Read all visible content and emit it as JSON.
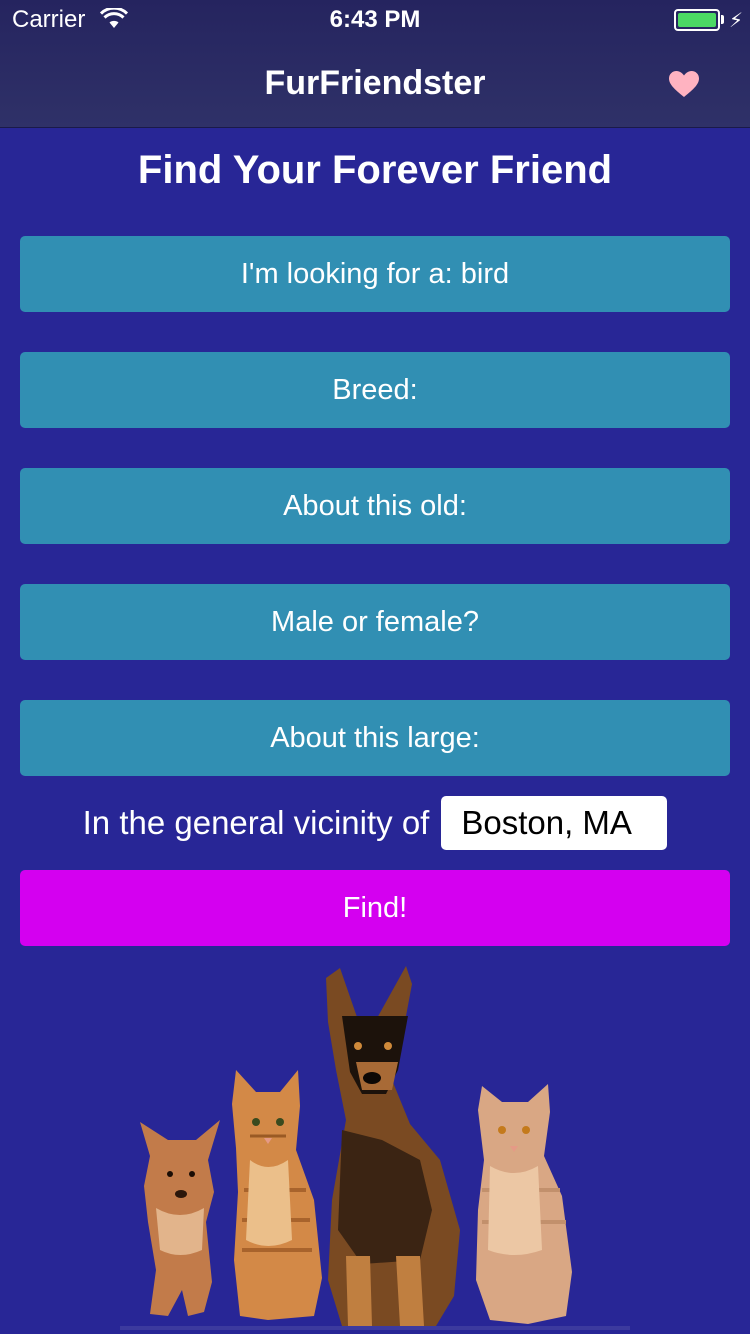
{
  "status_bar": {
    "carrier": "Carrier",
    "time": "6:43 PM"
  },
  "nav": {
    "title": "FurFriendster",
    "favorite_icon": "heart-icon"
  },
  "heading": "Find Your Forever Friend",
  "options": [
    {
      "label": "I'm looking for a: bird"
    },
    {
      "label": "Breed:"
    },
    {
      "label": "About this old:"
    },
    {
      "label": "Male or female?"
    },
    {
      "label": "About this large:"
    }
  ],
  "location": {
    "label": "In the general vicinity of",
    "value": "Boston, MA"
  },
  "find_label": "Find!",
  "colors": {
    "background": "#282696",
    "option_button": "#318fb3",
    "find_button": "#d400f0",
    "heart": "#ffb3c1"
  }
}
